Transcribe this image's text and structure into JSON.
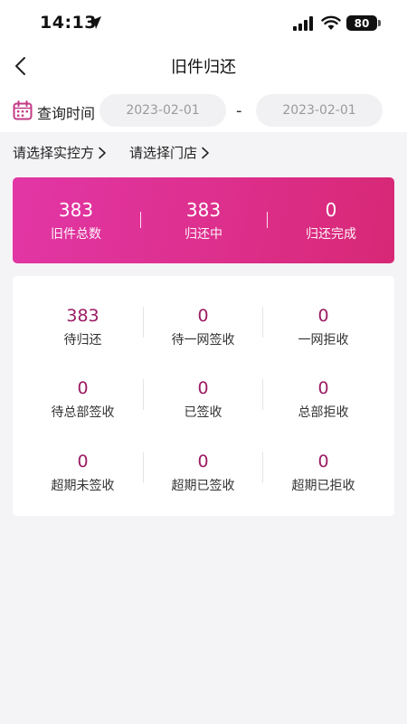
{
  "status_bar": {
    "time": "14:13",
    "battery": "80"
  },
  "nav": {
    "title": "旧件归还"
  },
  "query": {
    "label": "查询时间",
    "start_date": "2023-02-01",
    "separator": "-",
    "end_date": "2023-02-01"
  },
  "selectors": {
    "controller": "请选择实控方",
    "store": "请选择门店"
  },
  "summary": [
    {
      "value": "383",
      "label": "旧件总数"
    },
    {
      "value": "383",
      "label": "归还中"
    },
    {
      "value": "0",
      "label": "归还完成"
    }
  ],
  "stats": [
    {
      "value": "383",
      "label": "待归还"
    },
    {
      "value": "0",
      "label": "待一网签收"
    },
    {
      "value": "0",
      "label": "一网拒收"
    },
    {
      "value": "0",
      "label": "待总部签收"
    },
    {
      "value": "0",
      "label": "已签收"
    },
    {
      "value": "0",
      "label": "总部拒收"
    },
    {
      "value": "0",
      "label": "超期未签收"
    },
    {
      "value": "0",
      "label": "超期已签收"
    },
    {
      "value": "0",
      "label": "超期已拒收"
    }
  ],
  "colors": {
    "accent_pink": "#dd2f8c",
    "stat_value": "#9b1c64"
  }
}
